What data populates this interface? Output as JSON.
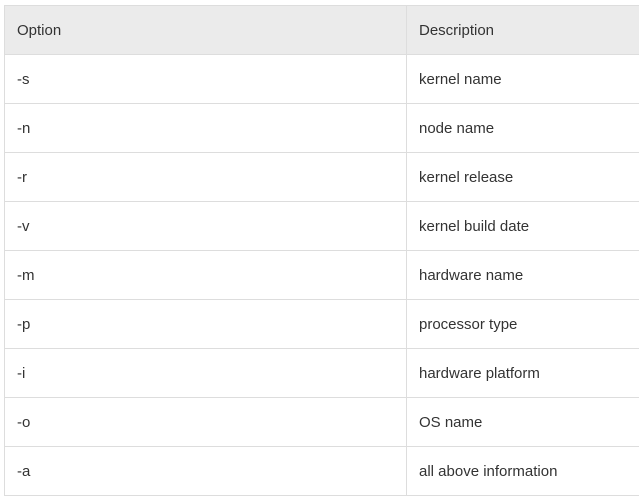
{
  "table": {
    "headers": [
      "Option",
      "Description"
    ],
    "rows": [
      [
        "-s",
        "kernel name"
      ],
      [
        "-n",
        "node name"
      ],
      [
        "-r",
        "kernel release"
      ],
      [
        "-v",
        "kernel build date"
      ],
      [
        "-m",
        "hardware name"
      ],
      [
        "-p",
        "processor type"
      ],
      [
        "-i",
        "hardware platform"
      ],
      [
        "-o",
        "OS name"
      ],
      [
        "-a",
        "all above information"
      ]
    ]
  }
}
